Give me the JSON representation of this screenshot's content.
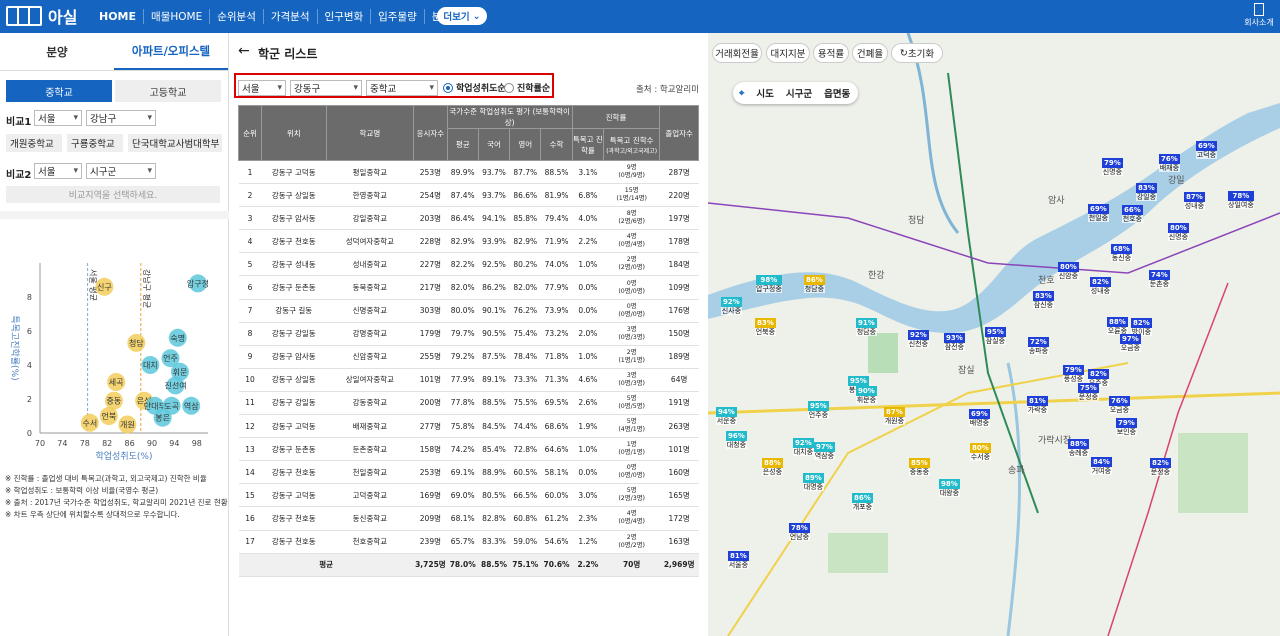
{
  "app": {
    "logo_text": "아실",
    "company_label": "회사소개",
    "more_label": "더보기"
  },
  "nav": [
    "HOME",
    "매물HOME",
    "순위분석",
    "가격분석",
    "인구변화",
    "입주물량",
    "분양"
  ],
  "left": {
    "tabs": [
      "분양",
      "아파트/오피스텔"
    ],
    "school_types": [
      "중학교",
      "고등학교"
    ],
    "compare1_label": "비교1",
    "compare1_region": "서울",
    "compare1_district": "강남구",
    "chips": [
      "개원중학교",
      "구룡중학교",
      "단국대학교사범대학부"
    ],
    "compare2_label": "비교2",
    "compare2_region": "서울",
    "compare2_district": "시구군",
    "compare_placeholder": "비교지역을 선택하세요.",
    "notes": [
      "※ 진학률 : 졸업생 대비 특목고(과학고, 외고국제고) 진학한 비율",
      "※ 학업성취도 : 보통학력 이상 비율(국영수 평균)",
      "※ 출처 : 2017년 국가수준 학업성취도, 학교알리미 2021년 진로 현황",
      "※ 차트 우측 상단에 위치할수록 상대적으로 우수합니다."
    ]
  },
  "chart_data": {
    "type": "scatter",
    "xlabel": "학업성취도(%)",
    "ylabel": "특목고진학률(%)",
    "xlim": [
      70,
      100
    ],
    "ylim": [
      0,
      10
    ],
    "xticks": [
      70,
      74,
      78,
      82,
      86,
      90,
      94,
      98
    ],
    "yticks": [
      0,
      2,
      4,
      6,
      8
    ],
    "ref_lines": [
      {
        "x": 78.5,
        "label": "서울 평균"
      },
      {
        "x": 88,
        "label": "강남구 평균"
      }
    ],
    "points": [
      {
        "label": "신구",
        "x": 81.5,
        "y": 8.6,
        "group": "seoul"
      },
      {
        "label": "압구정",
        "x": 98.2,
        "y": 8.8,
        "group": "gangnam"
      },
      {
        "label": "청담",
        "x": 87.2,
        "y": 5.3,
        "group": "seoul"
      },
      {
        "label": "숙명",
        "x": 94.6,
        "y": 5.6,
        "group": "gangnam"
      },
      {
        "label": "언주",
        "x": 93.3,
        "y": 4.4,
        "group": "gangnam"
      },
      {
        "label": "대치",
        "x": 89.7,
        "y": 4.0,
        "group": "gangnam"
      },
      {
        "label": "휘문",
        "x": 95.0,
        "y": 3.6,
        "group": "gangnam"
      },
      {
        "label": "진선여",
        "x": 94.2,
        "y": 2.8,
        "group": "gangnam"
      },
      {
        "label": "세곡",
        "x": 83.6,
        "y": 3.0,
        "group": "seoul"
      },
      {
        "label": "중동",
        "x": 83.2,
        "y": 1.9,
        "group": "seoul"
      },
      {
        "label": "은성",
        "x": 88.6,
        "y": 1.9,
        "group": "seoul"
      },
      {
        "label": "단대부",
        "x": 90.5,
        "y": 1.6,
        "group": "gangnam"
      },
      {
        "label": "도곡",
        "x": 93.5,
        "y": 1.6,
        "group": "gangnam"
      },
      {
        "label": "역삼",
        "x": 97.0,
        "y": 1.6,
        "group": "gangnam"
      },
      {
        "label": "언북",
        "x": 82.3,
        "y": 1.0,
        "group": "seoul"
      },
      {
        "label": "봉은",
        "x": 91.9,
        "y": 0.9,
        "group": "gangnam"
      },
      {
        "label": "수서",
        "x": 78.9,
        "y": 0.6,
        "group": "seoul"
      },
      {
        "label": "개원",
        "x": 85.6,
        "y": 0.5,
        "group": "seoul"
      }
    ]
  },
  "list": {
    "title": "학군 리스트",
    "region": "서울",
    "district": "강동구",
    "level": "중학교",
    "radio1": "학업성취도순",
    "radio2": "진학률순",
    "source": "출처 : 학교알리미",
    "headers": {
      "rank": "순위",
      "loc": "위치",
      "school": "학교명",
      "students": "응시자수",
      "nat": "국가수준 학업성취도 평가 (보통학력이상)",
      "avg": "평균",
      "kor": "국어",
      "eng": "영어",
      "math": "수학",
      "adv": "진학률",
      "rate": "특목고 진학률",
      "cnt": "특목고 진학수",
      "cnt_sub": "(과학고/외고국제고)",
      "grad": "졸업자수"
    },
    "rows": [
      [
        "1",
        "강동구 고덕동",
        "평일중학교",
        "253명",
        "89.9%",
        "93.7%",
        "87.7%",
        "88.5%",
        "3.1%",
        "9명",
        "(0명/9명)",
        "287명"
      ],
      [
        "2",
        "강동구 상일동",
        "한영중학교",
        "254명",
        "87.4%",
        "93.7%",
        "86.6%",
        "81.9%",
        "6.8%",
        "15명",
        "(1명/14명)",
        "220명"
      ],
      [
        "3",
        "강동구 암사동",
        "강일중학교",
        "203명",
        "86.4%",
        "94.1%",
        "85.8%",
        "79.4%",
        "4.0%",
        "8명",
        "(2명/6명)",
        "197명"
      ],
      [
        "4",
        "강동구 천호동",
        "성덕여자중학교",
        "228명",
        "82.9%",
        "93.9%",
        "82.9%",
        "71.9%",
        "2.2%",
        "4명",
        "(0명/4명)",
        "178명"
      ],
      [
        "5",
        "강동구 성내동",
        "성내중학교",
        "227명",
        "82.2%",
        "92.5%",
        "80.2%",
        "74.0%",
        "1.0%",
        "2명",
        "(2명/0명)",
        "184명"
      ],
      [
        "6",
        "강동구 둔촌동",
        "동북중학교",
        "217명",
        "82.0%",
        "86.2%",
        "82.0%",
        "77.9%",
        "0.0%",
        "0명",
        "(0명/0명)",
        "109명"
      ],
      [
        "7",
        "강동구 길동",
        "신명중학교",
        "303명",
        "80.0%",
        "90.1%",
        "76.2%",
        "73.9%",
        "0.0%",
        "0명",
        "(0명/0명)",
        "176명"
      ],
      [
        "8",
        "강동구 강일동",
        "강명중학교",
        "179명",
        "79.7%",
        "90.5%",
        "75.4%",
        "73.2%",
        "2.0%",
        "3명",
        "(0명/3명)",
        "150명"
      ],
      [
        "9",
        "강동구 암사동",
        "신암중학교",
        "255명",
        "79.2%",
        "87.5%",
        "78.4%",
        "71.8%",
        "1.0%",
        "2명",
        "(1명/1명)",
        "189명"
      ],
      [
        "10",
        "강동구 상일동",
        "상일여자중학교",
        "101명",
        "77.9%",
        "89.1%",
        "73.3%",
        "71.3%",
        "4.6%",
        "3명",
        "(0명/3명)",
        "64명"
      ],
      [
        "11",
        "강동구 강일동",
        "강동중학교",
        "200명",
        "77.8%",
        "88.5%",
        "75.5%",
        "69.5%",
        "2.6%",
        "5명",
        "(0명/5명)",
        "191명"
      ],
      [
        "12",
        "강동구 고덕동",
        "배재중학교",
        "277명",
        "75.8%",
        "84.5%",
        "74.4%",
        "68.6%",
        "1.9%",
        "5명",
        "(4명/1명)",
        "263명"
      ],
      [
        "13",
        "강동구 둔촌동",
        "둔촌중학교",
        "158명",
        "74.2%",
        "85.4%",
        "72.8%",
        "64.6%",
        "1.0%",
        "1명",
        "(0명/1명)",
        "101명"
      ],
      [
        "14",
        "강동구 천호동",
        "천일중학교",
        "253명",
        "69.1%",
        "88.9%",
        "60.5%",
        "58.1%",
        "0.0%",
        "0명",
        "(0명/0명)",
        "160명"
      ],
      [
        "15",
        "강동구 고덕동",
        "고덕중학교",
        "169명",
        "69.0%",
        "80.5%",
        "66.5%",
        "60.0%",
        "3.0%",
        "5명",
        "(2명/3명)",
        "165명"
      ],
      [
        "16",
        "강동구 천호동",
        "동신중학교",
        "209명",
        "68.1%",
        "82.8%",
        "60.8%",
        "61.2%",
        "2.3%",
        "4명",
        "(0명/4명)",
        "172명"
      ],
      [
        "17",
        "강동구 천호동",
        "천호중학교",
        "239명",
        "65.7%",
        "83.3%",
        "59.0%",
        "54.6%",
        "1.2%",
        "2명",
        "(0명/2명)",
        "163명"
      ]
    ],
    "avg_row": [
      "평균",
      "3,725명",
      "78.0%",
      "88.5%",
      "75.1%",
      "70.6%",
      "2.2%",
      "70명",
      "2,969명"
    ]
  },
  "map": {
    "buttons": [
      "거래회전율",
      "대지지분",
      "용적률",
      "건폐율",
      "초기화"
    ],
    "levels": [
      "시도",
      "시구군",
      "읍면동"
    ],
    "labels": [
      "한강",
      "잠실",
      "청담",
      "암사",
      "강일",
      "천호",
      "송파",
      "가락시장"
    ],
    "flags": [
      {
        "pct": "69%",
        "name": "고덕중",
        "color": "#1e3fd8"
      },
      {
        "pct": "79%",
        "name": "신명중",
        "color": "#1e3fd8"
      },
      {
        "pct": "76%",
        "name": "배재중",
        "color": "#1e3fd8"
      },
      {
        "pct": "83%",
        "name": "강일중",
        "color": "#1e3fd8"
      },
      {
        "pct": "87%",
        "name": "성내중",
        "color": "#1e3fd8"
      },
      {
        "pct": "78%",
        "name": "상일여중",
        "color": "#1e3fd8"
      },
      {
        "pct": "69%",
        "name": "천일중",
        "color": "#1e3fd8"
      },
      {
        "pct": "66%",
        "name": "천호중",
        "color": "#1e3fd8"
      },
      {
        "pct": "80%",
        "name": "신명중",
        "color": "#1e3fd8"
      },
      {
        "pct": "68%",
        "name": "동신중",
        "color": "#1e3fd8"
      },
      {
        "pct": "80%",
        "name": "신암중",
        "color": "#1e3fd8"
      },
      {
        "pct": "82%",
        "name": "성내중",
        "color": "#1e3fd8"
      },
      {
        "pct": "74%",
        "name": "둔촌중",
        "color": "#1e3fd8"
      },
      {
        "pct": "83%",
        "name": "잠신중",
        "color": "#1e3fd8"
      },
      {
        "pct": "88%",
        "name": "오륜중",
        "color": "#1e3fd8"
      },
      {
        "pct": "82%",
        "name": "방이중",
        "color": "#1e3fd8"
      },
      {
        "pct": "97%",
        "name": "오금중",
        "color": "#1e3fd8"
      },
      {
        "pct": "92%",
        "name": "신천중",
        "color": "#1e3fd8"
      },
      {
        "pct": "93%",
        "name": "잠전중",
        "color": "#1e3fd8"
      },
      {
        "pct": "95%",
        "name": "잠실중",
        "color": "#1e3fd8"
      },
      {
        "pct": "72%",
        "name": "송파중",
        "color": "#1e3fd8"
      },
      {
        "pct": "79%",
        "name": "풍성중",
        "color": "#1e3fd8"
      },
      {
        "pct": "82%",
        "name": "오주중",
        "color": "#1e3fd8"
      },
      {
        "pct": "81%",
        "name": "가락중",
        "color": "#1e3fd8"
      },
      {
        "pct": "75%",
        "name": "문정중",
        "color": "#1e3fd8"
      },
      {
        "pct": "76%",
        "name": "오금중",
        "color": "#1e3fd8"
      },
      {
        "pct": "79%",
        "name": "보인중",
        "color": "#1e3fd8"
      },
      {
        "pct": "69%",
        "name": "배명중",
        "color": "#1e3fd8"
      },
      {
        "pct": "88%",
        "name": "송례중",
        "color": "#1e3fd8"
      },
      {
        "pct": "84%",
        "name": "거여중",
        "color": "#1e3fd8"
      },
      {
        "pct": "82%",
        "name": "문정중",
        "color": "#1e3fd8"
      },
      {
        "pct": "98%",
        "name": "압구정중",
        "color": "#22bbcc"
      },
      {
        "pct": "91%",
        "name": "청담중",
        "color": "#22bbcc"
      },
      {
        "pct": "92%",
        "name": "신사중",
        "color": "#22bbcc"
      },
      {
        "pct": "95%",
        "name": "봉은중",
        "color": "#22bbcc"
      },
      {
        "pct": "90%",
        "name": "휘문중",
        "color": "#22bbcc"
      },
      {
        "pct": "95%",
        "name": "언주중",
        "color": "#22bbcc"
      },
      {
        "pct": "94%",
        "name": "서운중",
        "color": "#22bbcc"
      },
      {
        "pct": "96%",
        "name": "대청중",
        "color": "#22bbcc"
      },
      {
        "pct": "92%",
        "name": "대치중",
        "color": "#22bbcc"
      },
      {
        "pct": "97%",
        "name": "역삼중",
        "color": "#22bbcc"
      },
      {
        "pct": "89%",
        "name": "대명중",
        "color": "#22bbcc"
      },
      {
        "pct": "86%",
        "name": "개포중",
        "color": "#22bbcc"
      },
      {
        "pct": "98%",
        "name": "대왕중",
        "color": "#22bbcc"
      },
      {
        "pct": "87%",
        "name": "개원중",
        "color": "#e8b800"
      },
      {
        "pct": "85%",
        "name": "중동중",
        "color": "#e8b800"
      },
      {
        "pct": "80%",
        "name": "수서중",
        "color": "#e8b800"
      },
      {
        "pct": "88%",
        "name": "은성중",
        "color": "#e8b800"
      },
      {
        "pct": "86%",
        "name": "청담중",
        "color": "#e8b800"
      },
      {
        "pct": "83%",
        "name": "언북중",
        "color": "#e8b800"
      },
      {
        "pct": "78%",
        "name": "언남중",
        "color": "#1e3fd8"
      },
      {
        "pct": "81%",
        "name": "서울중",
        "color": "#1e3fd8"
      }
    ]
  },
  "colors": {
    "primary": "#1565c0",
    "scatter_seoul": "#f2cc5a",
    "scatter_gangnam": "#5cc8dc",
    "highlight": "#dd0000"
  }
}
